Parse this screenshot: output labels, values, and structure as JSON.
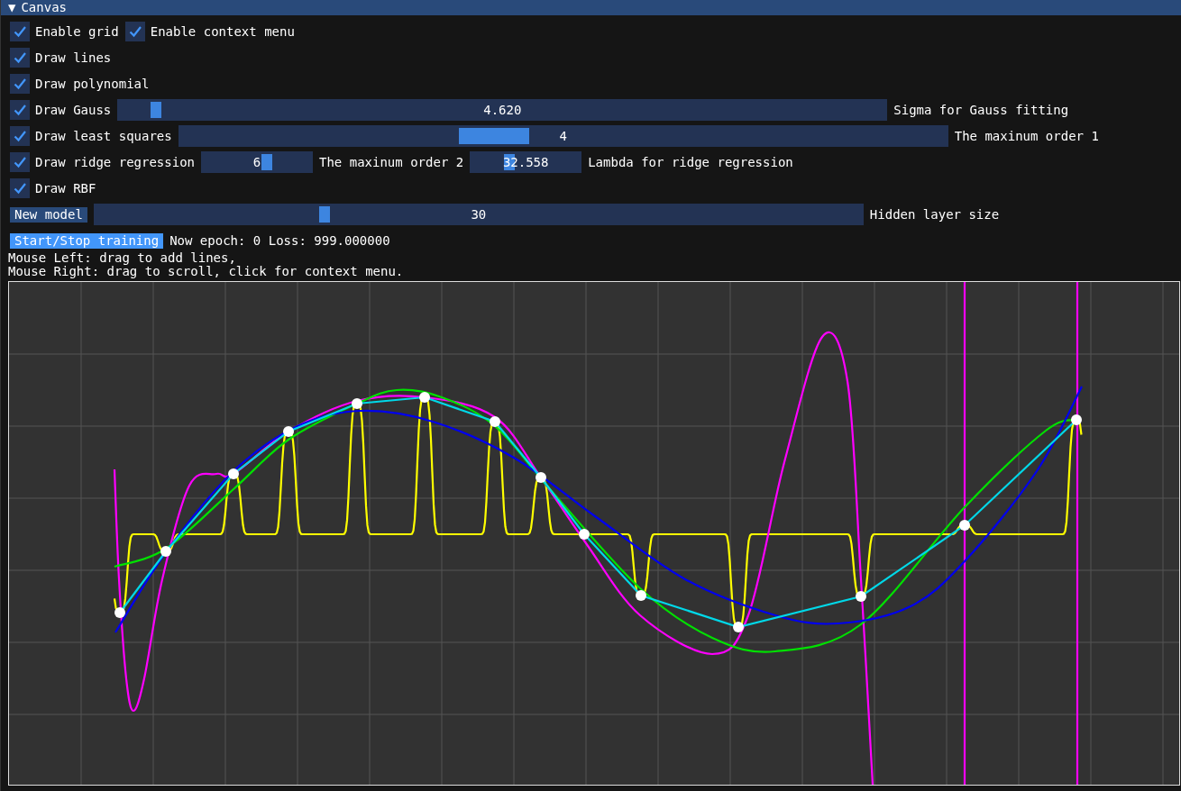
{
  "header": {
    "arrow": "▼",
    "title": "Canvas"
  },
  "rows": [
    {
      "items": [
        {
          "kind": "checkbox",
          "label": "Enable grid",
          "checked": true
        },
        {
          "kind": "checkbox",
          "label": "Enable context menu",
          "checked": true
        }
      ]
    },
    {
      "items": [
        {
          "kind": "checkbox",
          "label": "Draw lines",
          "checked": true
        }
      ]
    },
    {
      "items": [
        {
          "kind": "checkbox",
          "label": "Draw polynomial",
          "checked": true
        }
      ]
    },
    {
      "items": [
        {
          "kind": "checkbox",
          "label": "Draw Gauss",
          "checked": true
        },
        {
          "kind": "slider",
          "value": "4.620",
          "level": 0.05
        },
        {
          "kind": "label",
          "text": "Sigma for Gauss fitting"
        }
      ]
    },
    {
      "items": [
        {
          "kind": "checkbox",
          "label": "Draw least squares",
          "checked": true
        },
        {
          "kind": "int-slider",
          "value": "4",
          "level": 0.41
        },
        {
          "kind": "label",
          "text": "The maxinum order 1"
        }
      ]
    },
    {
      "items": [
        {
          "kind": "checkbox",
          "label": "Draw ridge regression",
          "checked": true
        },
        {
          "kind": "small-slider",
          "value": "6",
          "level": 0.59
        },
        {
          "kind": "label",
          "text": "The maxinum order 2"
        },
        {
          "kind": "small-slider",
          "value": "32.558",
          "level": 0.35
        },
        {
          "kind": "label",
          "text": "Lambda for ridge regression"
        }
      ]
    },
    {
      "items": [
        {
          "kind": "checkbox",
          "label": "Draw RBF",
          "checked": true
        }
      ]
    },
    {
      "items": [
        {
          "kind": "button",
          "label": "New model",
          "hovered": false
        },
        {
          "kind": "slider",
          "value": "30",
          "level": 0.3
        },
        {
          "kind": "label",
          "text": "Hidden layer size"
        }
      ]
    },
    {
      "items": [
        {
          "kind": "button",
          "label": "Start/Stop training",
          "hovered": true
        },
        {
          "kind": "label",
          "text": "Now epoch: 0 Loss: 999.000000"
        }
      ]
    }
  ],
  "help": [
    "Mouse Left: drag to add lines,",
    "Mouse Right: drag to scroll, click for context menu."
  ]
}
